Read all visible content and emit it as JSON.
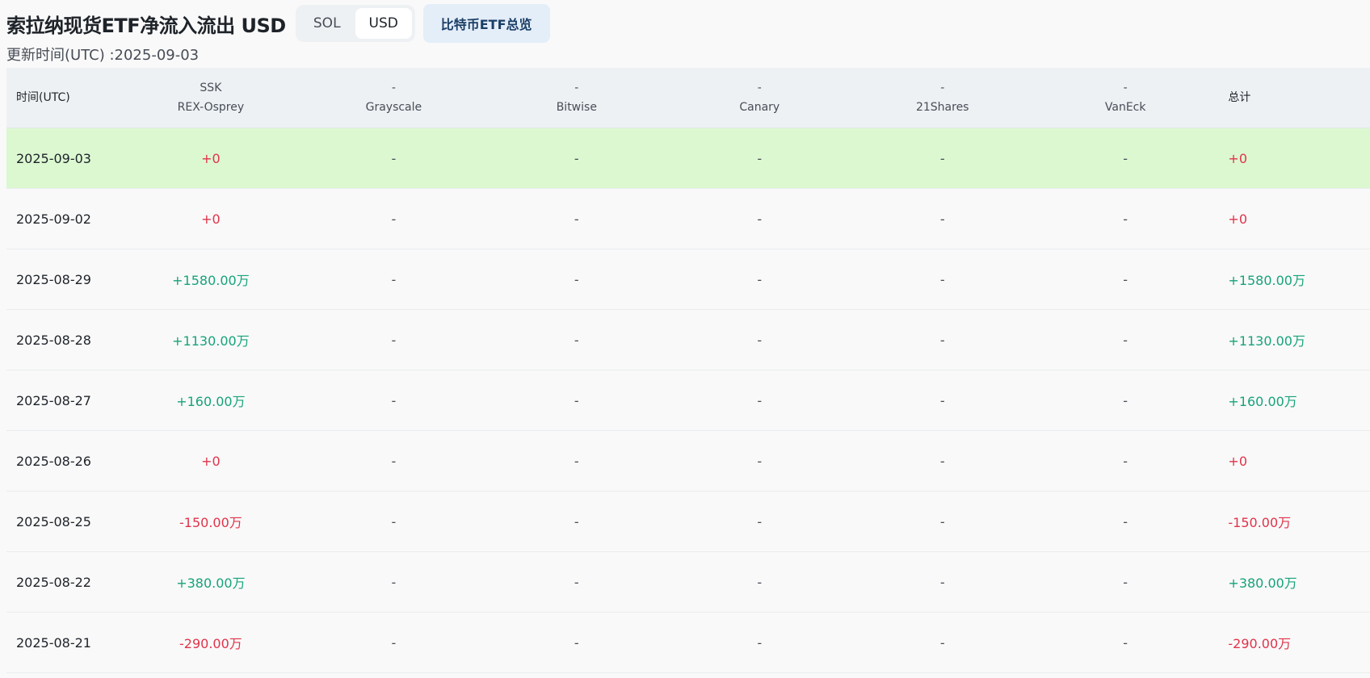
{
  "header": {
    "title": "索拉纳现货ETF净流入流出 USD",
    "toggles": [
      {
        "label": "SOL",
        "active": false
      },
      {
        "label": "USD",
        "active": true
      }
    ],
    "overview_button": "比特币ETF总览",
    "updated": "更新时间(UTC) :2025-09-03"
  },
  "table": {
    "date_header": "时间(UTC)",
    "total_header": "总计",
    "issuers": [
      {
        "ticker": "SSK",
        "name": "REX-Osprey"
      },
      {
        "ticker": "-",
        "name": "Grayscale"
      },
      {
        "ticker": "-",
        "name": "Bitwise"
      },
      {
        "ticker": "-",
        "name": "Canary"
      },
      {
        "ticker": "-",
        "name": "21Shares"
      },
      {
        "ticker": "-",
        "name": "VanEck"
      }
    ],
    "rows": [
      {
        "date": "2025-09-03",
        "values": [
          "+0",
          "-",
          "-",
          "-",
          "-",
          "-"
        ],
        "total": "+0",
        "highlight": true
      },
      {
        "date": "2025-09-02",
        "values": [
          "+0",
          "-",
          "-",
          "-",
          "-",
          "-"
        ],
        "total": "+0"
      },
      {
        "date": "2025-08-29",
        "values": [
          "+1580.00万",
          "-",
          "-",
          "-",
          "-",
          "-"
        ],
        "total": "+1580.00万"
      },
      {
        "date": "2025-08-28",
        "values": [
          "+1130.00万",
          "-",
          "-",
          "-",
          "-",
          "-"
        ],
        "total": "+1130.00万"
      },
      {
        "date": "2025-08-27",
        "values": [
          "+160.00万",
          "-",
          "-",
          "-",
          "-",
          "-"
        ],
        "total": "+160.00万"
      },
      {
        "date": "2025-08-26",
        "values": [
          "+0",
          "-",
          "-",
          "-",
          "-",
          "-"
        ],
        "total": "+0"
      },
      {
        "date": "2025-08-25",
        "values": [
          "-150.00万",
          "-",
          "-",
          "-",
          "-",
          "-"
        ],
        "total": "-150.00万"
      },
      {
        "date": "2025-08-22",
        "values": [
          "+380.00万",
          "-",
          "-",
          "-",
          "-",
          "-"
        ],
        "total": "+380.00万"
      },
      {
        "date": "2025-08-21",
        "values": [
          "-290.00万",
          "-",
          "-",
          "-",
          "-",
          "-"
        ],
        "total": "-290.00万"
      }
    ]
  },
  "colors": {
    "positive": "#16a37a",
    "negative": "#e0334a",
    "highlight_row": "#dcf8d1"
  }
}
